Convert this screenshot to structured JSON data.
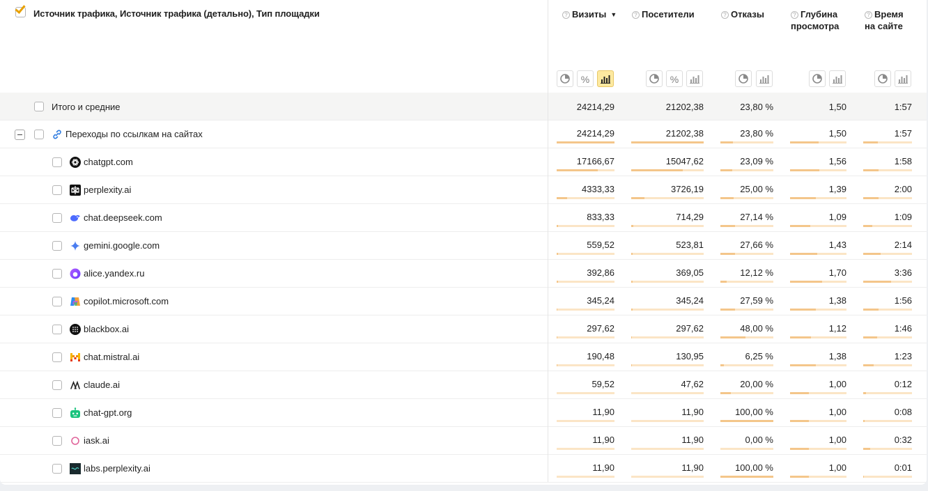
{
  "header": {
    "dimension_title": "Источник трафика, Источник трафика (детально), Тип площадки",
    "columns": [
      {
        "lines": [
          "Визиты"
        ],
        "sort": "▼"
      },
      {
        "lines": [
          "Посетители"
        ]
      },
      {
        "lines": [
          "Отказы"
        ]
      },
      {
        "lines": [
          "Глубина",
          "просмотра"
        ]
      },
      {
        "lines": [
          "Время",
          "на сайте"
        ]
      }
    ],
    "help_glyph": "?",
    "percent_glyph": "%"
  },
  "total": {
    "label": "Итого и средние",
    "values": [
      "24214,29",
      "21202,38",
      "23,80 %",
      "1,50",
      "1:57"
    ]
  },
  "group": {
    "label": "Переходы по ссылкам на сайтах",
    "icon": "link-icon",
    "values": [
      "24214,29",
      "21202,38",
      "23,80 %",
      "1,50",
      "1:57"
    ],
    "fill": [
      1.0,
      1.0,
      0.24,
      0.5,
      0.3
    ]
  },
  "rows": [
    {
      "label": "chatgpt.com",
      "icon": "chatgpt-icon",
      "values": [
        "17166,67",
        "15047,62",
        "23,09 %",
        "1,56",
        "1:58"
      ],
      "fill": [
        0.71,
        0.71,
        0.23,
        0.52,
        0.31
      ]
    },
    {
      "label": "perplexity.ai",
      "icon": "perplexity-icon",
      "values": [
        "4333,33",
        "3726,19",
        "25,00 %",
        "1,39",
        "2:00"
      ],
      "fill": [
        0.18,
        0.18,
        0.25,
        0.46,
        0.32
      ]
    },
    {
      "label": "chat.deepseek.com",
      "icon": "deepseek-icon",
      "values": [
        "833,33",
        "714,29",
        "27,14 %",
        "1,09",
        "1:09"
      ],
      "fill": [
        0.03,
        0.03,
        0.27,
        0.36,
        0.18
      ]
    },
    {
      "label": "gemini.google.com",
      "icon": "gemini-icon",
      "values": [
        "559,52",
        "523,81",
        "27,66 %",
        "1,43",
        "2:14"
      ],
      "fill": [
        0.02,
        0.02,
        0.28,
        0.48,
        0.36
      ]
    },
    {
      "label": "alice.yandex.ru",
      "icon": "alice-icon",
      "values": [
        "392,86",
        "369,05",
        "12,12 %",
        "1,70",
        "3:36"
      ],
      "fill": [
        0.02,
        0.02,
        0.12,
        0.57,
        0.57
      ]
    },
    {
      "label": "copilot.microsoft.com",
      "icon": "copilot-icon",
      "values": [
        "345,24",
        "345,24",
        "27,59 %",
        "1,38",
        "1:56"
      ],
      "fill": [
        0.01,
        0.02,
        0.28,
        0.46,
        0.31
      ]
    },
    {
      "label": "blackbox.ai",
      "icon": "blackbox-icon",
      "values": [
        "297,62",
        "297,62",
        "48,00 %",
        "1,12",
        "1:46"
      ],
      "fill": [
        0.01,
        0.01,
        0.48,
        0.37,
        0.28
      ]
    },
    {
      "label": "chat.mistral.ai",
      "icon": "mistral-icon",
      "values": [
        "190,48",
        "130,95",
        "6,25 %",
        "1,38",
        "1:23"
      ],
      "fill": [
        0.01,
        0.01,
        0.06,
        0.46,
        0.22
      ]
    },
    {
      "label": "claude.ai",
      "icon": "claude-icon",
      "values": [
        "59,52",
        "47,62",
        "20,00 %",
        "1,00",
        "0:12"
      ],
      "fill": [
        0.0,
        0.0,
        0.2,
        0.33,
        0.05
      ]
    },
    {
      "label": "chat-gpt.org",
      "icon": "chatgpt-org-icon",
      "values": [
        "11,90",
        "11,90",
        "100,00 %",
        "1,00",
        "0:08"
      ],
      "fill": [
        0.0,
        0.0,
        1.0,
        0.33,
        0.03
      ]
    },
    {
      "label": "iask.ai",
      "icon": "iask-icon",
      "values": [
        "11,90",
        "11,90",
        "0,00 %",
        "1,00",
        "0:32"
      ],
      "fill": [
        0.0,
        0.0,
        0.0,
        0.33,
        0.14
      ]
    },
    {
      "label": "labs.perplexity.ai",
      "icon": "labs-perplexity-icon",
      "values": [
        "11,90",
        "11,90",
        "100,00 %",
        "1,00",
        "0:01"
      ],
      "fill": [
        0.0,
        0.0,
        1.0,
        0.33,
        0.01
      ]
    }
  ]
}
